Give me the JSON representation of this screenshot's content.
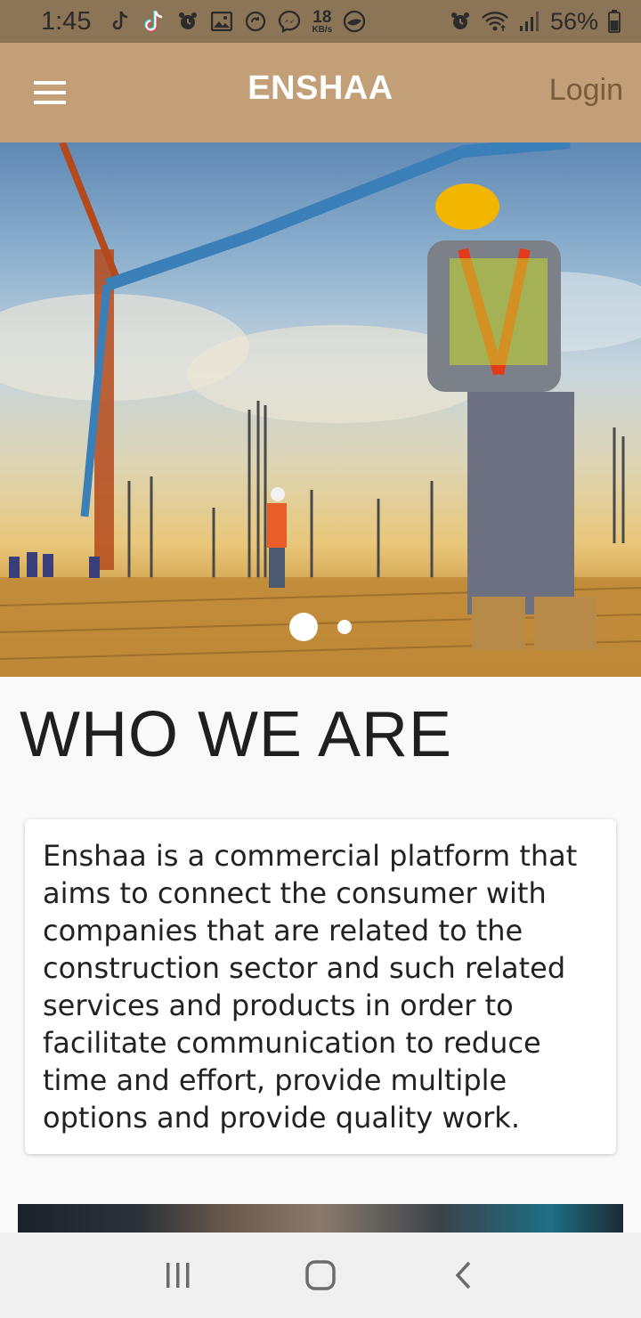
{
  "status_bar": {
    "time": "1:45",
    "net_speed_value": "18",
    "net_speed_unit": "KB/s",
    "battery": "56%",
    "icons": [
      "tiktok-icon",
      "tiktok-icon",
      "alarm-icon",
      "gallery-icon",
      "sync-icon",
      "messenger-icon",
      "vpn-icon",
      "alarm-icon",
      "wifi-icon",
      "signal-icon",
      "battery-icon"
    ]
  },
  "app_bar": {
    "title": "ENSHAA",
    "login_label": "Login",
    "background": "#c39f77"
  },
  "hero": {
    "image": "construction-site-photo",
    "slides_total": 2,
    "active_slide": 1
  },
  "about": {
    "heading": "WHO WE ARE",
    "body": "Enshaa is a commercial platform that aims to connect the consumer with companies that are related to the construction sector and such related services and products in order to facilitate communication to reduce time and effort, provide multiple options and provide quality work."
  },
  "nav_bar": {
    "icons": [
      "recent-apps-icon",
      "home-icon",
      "back-icon"
    ]
  }
}
